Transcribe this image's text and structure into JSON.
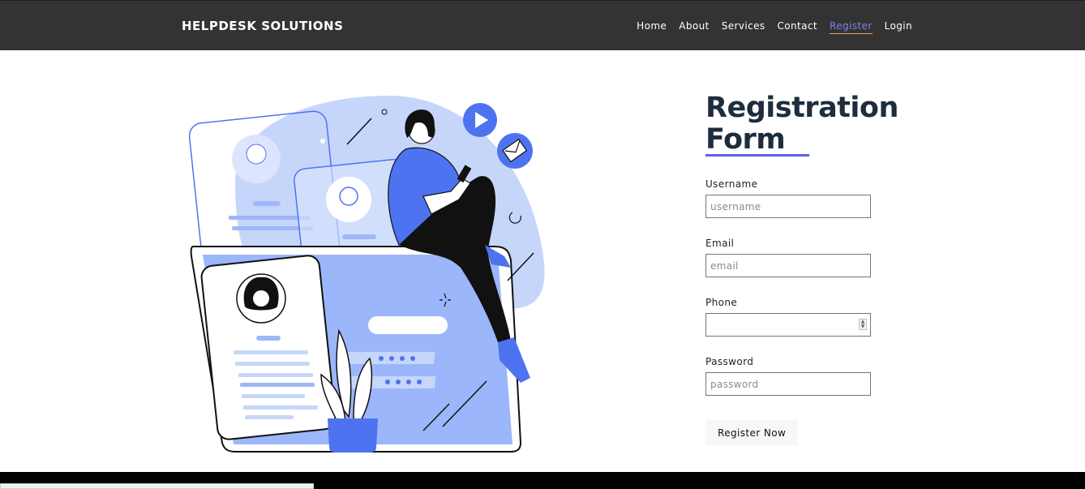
{
  "header": {
    "brand": "HELPDESK SOLUTIONS",
    "nav": [
      {
        "label": "Home",
        "active": false
      },
      {
        "label": "About",
        "active": false
      },
      {
        "label": "Services",
        "active": false
      },
      {
        "label": "Contact",
        "active": false
      },
      {
        "label": "Register",
        "active": true
      },
      {
        "label": "Login",
        "active": false
      }
    ]
  },
  "form": {
    "title_line1": "Registration",
    "title_line2": "Form",
    "fields": {
      "username": {
        "label": "Username",
        "placeholder": "username",
        "value": ""
      },
      "email": {
        "label": "Email",
        "placeholder": "email",
        "value": ""
      },
      "phone": {
        "label": "Phone",
        "value": ""
      },
      "password": {
        "label": "Password",
        "placeholder": "password",
        "value": ""
      }
    },
    "submit_label": "Register Now"
  },
  "colors": {
    "navbar_bg": "#333333",
    "accent": "#5b62e8",
    "illustration_blue": "#4e73f0",
    "illustration_light": "#c6d6fb",
    "title_color": "#1e2d3d"
  },
  "icons": [
    "play-icon",
    "mail-icon",
    "avatar-icon"
  ]
}
